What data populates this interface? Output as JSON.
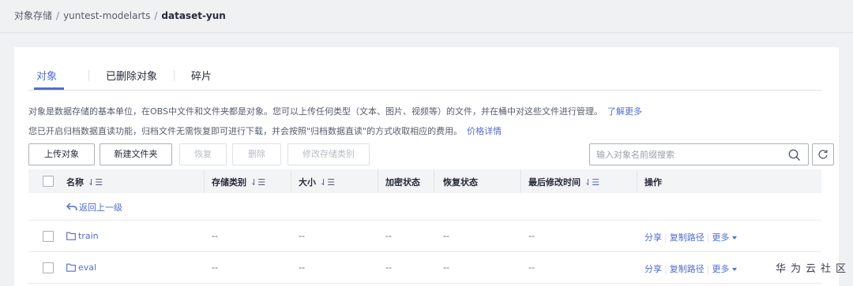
{
  "breadcrumb": {
    "root": "对象存储",
    "bucket": "yuntest-modelarts",
    "current": "dataset-yun",
    "separator": "/"
  },
  "tabs": [
    {
      "label": "对象",
      "active": true
    },
    {
      "label": "已删除对象",
      "active": false
    },
    {
      "label": "碎片",
      "active": false
    }
  ],
  "description": {
    "line1": "对象是数据存储的基本单位，在OBS中文件和文件夹都是对象。您可以上传任何类型（文本、图片、视频等）的文件，并在桶中对这些文件进行管理。",
    "line1_link": "了解更多",
    "line2": "您已开启归档数据直读功能，归档文件无需恢复即可进行下载，并会按照\"归档数据直读\"的方式收取相应的费用。",
    "line2_link": "价格详情"
  },
  "toolbar": {
    "upload": "上传对象",
    "new_folder": "新建文件夹",
    "restore": "恢复",
    "delete": "删除",
    "change_storage": "修改存储类别",
    "search_placeholder": "输入对象名前缀搜索"
  },
  "table": {
    "columns": {
      "name": "名称",
      "storage_class": "存储类别",
      "size": "大小",
      "encryption": "加密状态",
      "restore_status": "恢复状态",
      "last_modified": "最后修改时间",
      "actions": "操作"
    },
    "back_link": "返回上一级",
    "rows": [
      {
        "name": "train",
        "storage_class": "--",
        "size": "--",
        "encryption": "--",
        "restore_status": "--",
        "last_modified": "--"
      },
      {
        "name": "eval",
        "storage_class": "--",
        "size": "--",
        "encryption": "--",
        "restore_status": "--",
        "last_modified": "--"
      }
    ],
    "row_actions": {
      "share": "分享",
      "copy_path": "复制路径",
      "more": "更多"
    }
  },
  "watermark": "华为云社区",
  "colors": {
    "accent": "#526ecc",
    "text": "#252b3a",
    "muted": "#575d6c",
    "background": "#f0f1f3"
  },
  "icons": [
    "search-icon",
    "refresh-icon",
    "folder-icon",
    "back-arrow-icon",
    "sort-icon",
    "caret-down-icon"
  ]
}
